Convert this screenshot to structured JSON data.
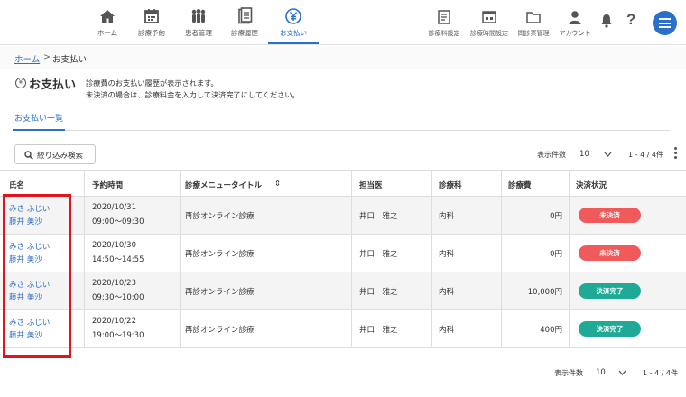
{
  "nav": {
    "items": [
      {
        "label": "ホーム",
        "icon": "home-icon"
      },
      {
        "label": "診療予約",
        "icon": "calendar-icon"
      },
      {
        "label": "患者管理",
        "icon": "patients-icon"
      },
      {
        "label": "診療履歴",
        "icon": "history-icon"
      },
      {
        "label": "お支払い",
        "icon": "yen-icon"
      }
    ],
    "right_items": [
      {
        "label": "診療料設定",
        "icon": "fee-settings-icon"
      },
      {
        "label": "診療時間設定",
        "icon": "hours-settings-icon"
      },
      {
        "label": "問診票管理",
        "icon": "folder-icon"
      },
      {
        "label": "アカウント",
        "icon": "account-icon"
      }
    ],
    "help_glyph": "?"
  },
  "breadcrumb": {
    "home": "ホーム",
    "separator": ">",
    "current": "お支払い"
  },
  "page": {
    "icon_glyph": "¥",
    "title": "お支払い",
    "desc_line1": "診療費のお支払い履歴が表示されます。",
    "desc_line2": "未決済の場合は、診療料金を入力して決済完了にしてください。"
  },
  "tab": {
    "label": "お支払い一覧"
  },
  "filter": {
    "label": "絞り込み検索"
  },
  "pagination": {
    "per_page_label": "表示件数",
    "per_page_value": "10",
    "count": "1 - 4 / 4件"
  },
  "table": {
    "headers": [
      "氏名",
      "予約時間",
      "診療メニュータイトル",
      "担当医",
      "診療科",
      "診療費",
      "決済状況"
    ],
    "sort_glyph": "⇕",
    "rows": [
      {
        "kana": "みさ ふじい",
        "name": "藤井 美沙",
        "date": "2020/10/31",
        "time": "09:00〜09:30",
        "menu": "再診オンライン診療",
        "doctor": "井口　雅之",
        "dept": "内科",
        "fee": "0円",
        "status": "未決済",
        "status_type": "unpaid"
      },
      {
        "kana": "みさ ふじい",
        "name": "藤井 美沙",
        "date": "2020/10/30",
        "time": "14:50〜14:55",
        "menu": "再診オンライン診療",
        "doctor": "井口　雅之",
        "dept": "内科",
        "fee": "0円",
        "status": "未決済",
        "status_type": "unpaid"
      },
      {
        "kana": "みさ ふじい",
        "name": "藤井 美沙",
        "date": "2020/10/23",
        "time": "09:30〜10:00",
        "menu": "再診オンライン診療",
        "doctor": "井口　雅之",
        "dept": "内科",
        "fee": "10,000円",
        "status": "決済完了",
        "status_type": "paid"
      },
      {
        "kana": "みさ ふじい",
        "name": "藤井 美沙",
        "date": "2020/10/22",
        "time": "19:00〜19:30",
        "menu": "再診オンライン診療",
        "doctor": "井口　雅之",
        "dept": "内科",
        "fee": "400円",
        "status": "決済完了",
        "status_type": "paid"
      }
    ]
  },
  "colors": {
    "accent": "#2a6fc9",
    "unpaid": "#f15a5a",
    "paid": "#1eaa96",
    "highlight": "#e0141c"
  }
}
